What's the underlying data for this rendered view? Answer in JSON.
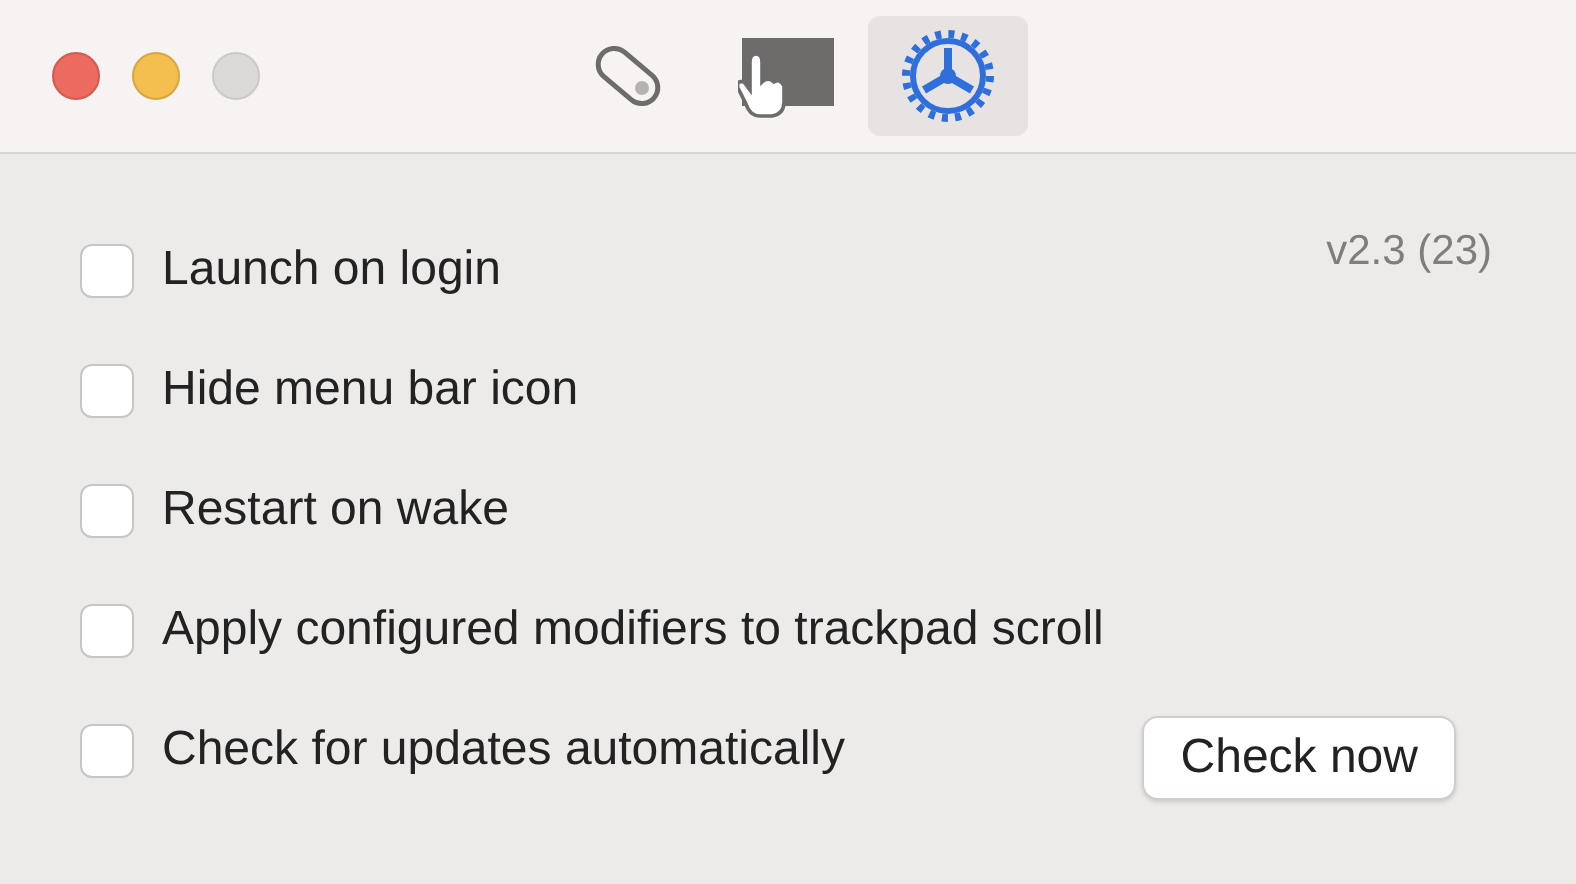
{
  "toolbar": {
    "tabs": [
      {
        "kind": "mouse",
        "selected": false
      },
      {
        "kind": "trackpad",
        "selected": false
      },
      {
        "kind": "gear",
        "selected": true
      }
    ]
  },
  "settings": {
    "options": [
      {
        "label": "Launch on login",
        "checked": false
      },
      {
        "label": "Hide menu bar icon",
        "checked": false
      },
      {
        "label": "Restart on wake",
        "checked": false
      },
      {
        "label": "Apply configured modifiers to trackpad scroll",
        "checked": false
      },
      {
        "label": "Check for updates automatically",
        "checked": false
      }
    ],
    "version": "v2.3 (23)",
    "button": "Check now"
  }
}
